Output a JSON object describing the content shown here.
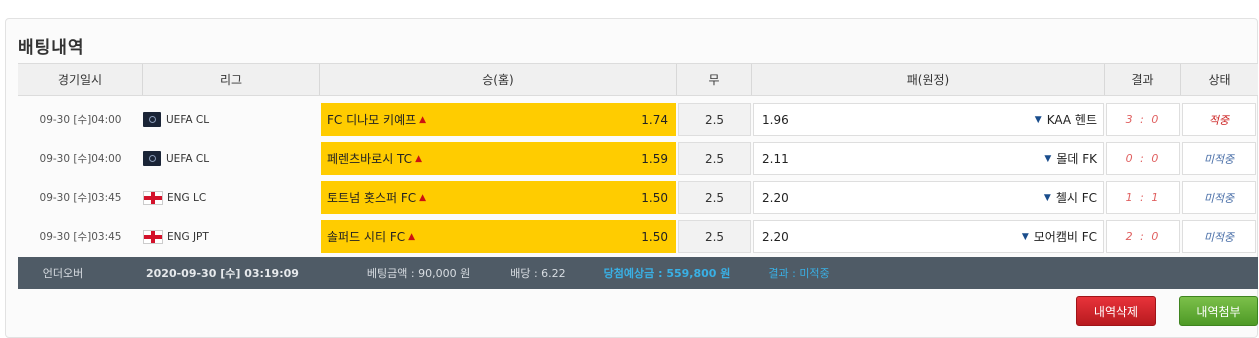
{
  "title": "배팅내역",
  "headers": [
    "경기일시",
    "리그",
    "승(홈)",
    "무",
    "패(원정)",
    "결과",
    "상태"
  ],
  "rows": [
    {
      "date": "09-30 [수]04:00",
      "league": "UEFA CL",
      "league_icon": "ucl-logo-icon",
      "home": "FC 디나모 키예프",
      "home_odds": "1.74",
      "draw": "2.5",
      "away_odds": "1.96",
      "away": "KAA 헨트",
      "result": "3 : 0",
      "status": "적중"
    },
    {
      "date": "09-30 [수]04:00",
      "league": "UEFA CL",
      "league_icon": "ucl-logo-icon",
      "home": "페렌츠바로시 TC",
      "home_odds": "1.59",
      "draw": "2.5",
      "away_odds": "2.11",
      "away": "몰데 FK",
      "result": "0 : 0",
      "status": "미적중"
    },
    {
      "date": "09-30 [수]03:45",
      "league": "ENG LC",
      "league_icon": "england-flag-icon",
      "home": "토트넘 홋스퍼 FC",
      "home_odds": "1.50",
      "draw": "2.5",
      "away_odds": "2.20",
      "away": "첼시 FC",
      "result": "1 : 1",
      "status": "미적중"
    },
    {
      "date": "09-30 [수]03:45",
      "league": "ENG JPT",
      "league_icon": "england-flag-icon",
      "home": "솔퍼드 시티 FC",
      "home_odds": "1.50",
      "draw": "2.5",
      "away_odds": "2.20",
      "away": "모어캠비 FC",
      "result": "2 : 0",
      "status": "미적중"
    }
  ],
  "summary": {
    "type": "언더오버",
    "datetime": "2020-09-30 [수] 03:19:09",
    "bet_amount": "베팅금액 : 90,000 원",
    "odds": "배당 : 6.22",
    "expected": "당첨예상금 : 559,800 원",
    "result": "결과 : 미적중"
  },
  "buttons": {
    "delete": "내역삭제",
    "attach": "내역첨부"
  },
  "colors": {
    "home_bg": "#ffcc00",
    "win_status": "#cc2222",
    "lose_status": "#4a6fa8",
    "result": "#e06060",
    "summary_bg": "#4f5b66",
    "expected_text": "#39b0e5"
  }
}
